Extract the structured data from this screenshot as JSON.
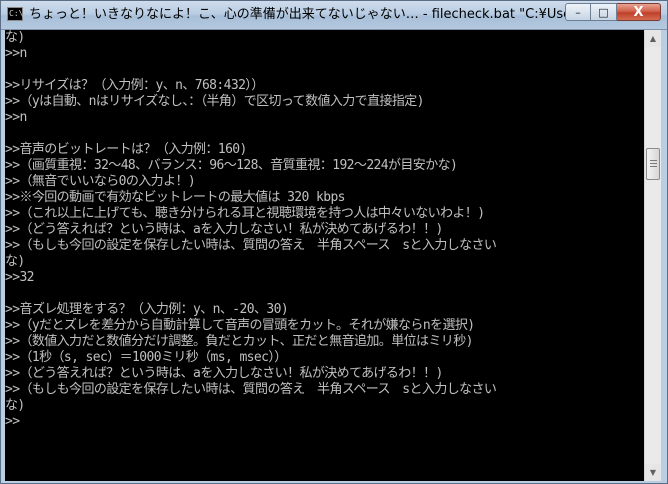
{
  "window": {
    "title": "ちょっと！いきなりなによ！こ、心の準備が出来てないじゃない… - filecheck.bat   \"C:¥Users....",
    "icon_label": "C:\\",
    "icon_name": "cmd-icon",
    "buttons": {
      "minimize": "–",
      "maximize": "□",
      "close": "X"
    }
  },
  "console": {
    "lines": [
      "な)",
      ">>n",
      "",
      ">>リサイズは？（入力例：y、n、768:432））",
      ">>（yは自動、nはリサイズなし、：（半角）で区切って数値入力で直接指定)",
      ">>n",
      "",
      ">>音声のビットレートは？（入力例：160)",
      ">>（画質重視：32〜48、バランス：96〜128、音質重視：192〜224が目安かな)",
      ">>（無音でいいなら0の入力よ！)",
      ">>※今回の動画で有効なビットレートの最大値は 320 kbps",
      ">>（これ以上に上げても、聴き分けられる耳と視聴環境を持つ人は中々いないわよ！)",
      ">>（どう答えれば？という時は、aを入力しなさい！私が決めてあげるわ！！)",
      ">>（もしも今回の設定を保存したい時は、質問の答え　半角スペース　sと入力しなさい",
      "な)",
      ">>32",
      "",
      ">>音ズレ処理をする？（入力例：y、n、-20、30)",
      ">>（yだとズレを差分から自動計算して音声の冒頭をカット。それが嫌ならnを選択)",
      ">>（数値入力だと数値分だけ調整。負だとカット、正だと無音追加。単位はミリ秒)",
      ">>（1秒（s, sec）＝1000ミリ秒（ms, msec））",
      ">>（どう答えれば？という時は、aを入力しなさい！私が決めてあげるわ！！)",
      ">>（もしも今回の設定を保存したい時は、質問の答え　半角スペース　sと入力しなさい",
      "な)",
      ">>"
    ]
  },
  "colors": {
    "console_bg": "#000000",
    "console_text": "#c0c0c0",
    "close_button": "#c0402a"
  }
}
